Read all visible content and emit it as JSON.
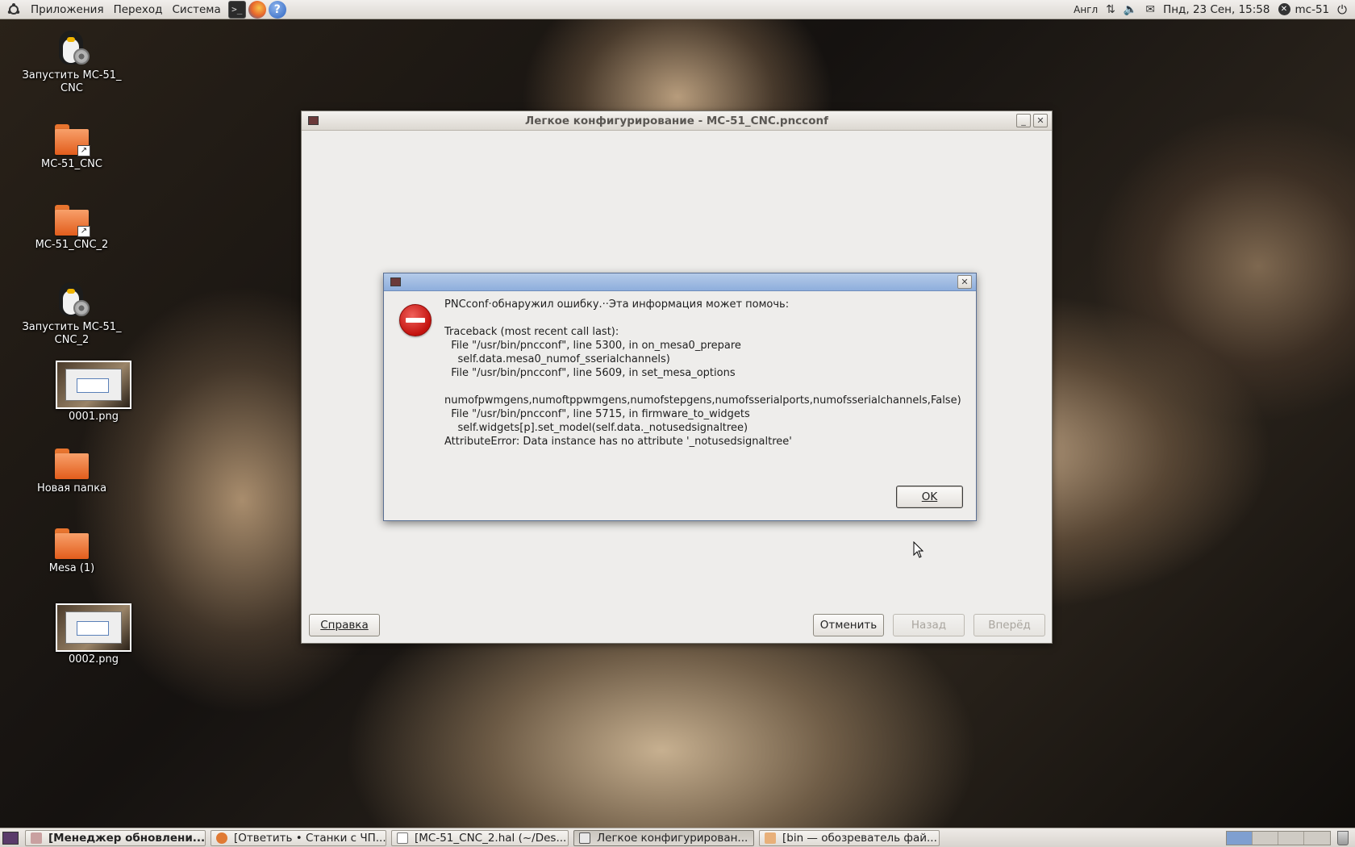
{
  "top_panel": {
    "menus": [
      "Приложения",
      "Переход",
      "Система"
    ],
    "keyboard_layout": "Англ",
    "clock": "Пнд, 23 Сен, 15:58",
    "user": "mc-51"
  },
  "desktop_icons": [
    {
      "label": "Запустить MC-51_\nCNC",
      "type": "launcher"
    },
    {
      "label": "MC-51_CNC",
      "type": "folder-link"
    },
    {
      "label": "MC-51_CNC_2",
      "type": "folder-link"
    },
    {
      "label": "Запустить MC-51_\nCNC_2",
      "type": "launcher"
    },
    {
      "label": "0001.png",
      "type": "image"
    },
    {
      "label": "Новая папка",
      "type": "folder"
    },
    {
      "label": "Mesa (1)",
      "type": "folder"
    },
    {
      "label": "0002.png",
      "type": "image"
    }
  ],
  "main_window": {
    "title": "Легкое конфигурирование - MC-51_CNC.pncconf",
    "buttons": {
      "help": "Справка",
      "cancel": "Отменить",
      "back": "Назад",
      "forward": "Вперёд"
    }
  },
  "dialog": {
    "message": "PNCconf·обнаружил ошибку.··Эта информация может помочь:\n\nTraceback (most recent call last):\n  File \"/usr/bin/pncconf\", line 5300, in on_mesa0_prepare\n    self.data.mesa0_numof_sserialchannels)\n  File \"/usr/bin/pncconf\", line 5609, in set_mesa_options\n\nnumofpwmgens,numoftppwmgens,numofstepgens,numofsserialports,numofsserialchannels,False)\n  File \"/usr/bin/pncconf\", line 5715, in firmware_to_widgets\n    self.widgets[p].set_model(self.data._notusedsignaltree)\nAttributeError: Data instance has no attribute '_notusedsignaltree'",
    "ok_label": "OK"
  },
  "taskbar": {
    "tasks": [
      {
        "label": "[Менеджер обновлени...",
        "bold": true,
        "active": false
      },
      {
        "label": "[Ответить • Станки с ЧП...",
        "bold": false,
        "active": false
      },
      {
        "label": "[MC-51_CNC_2.hal (~/Des...",
        "bold": false,
        "active": false
      },
      {
        "label": "Легкое конфигурирован...",
        "bold": false,
        "active": true
      },
      {
        "label": "[bin — обозреватель фай...",
        "bold": false,
        "active": false
      }
    ]
  }
}
